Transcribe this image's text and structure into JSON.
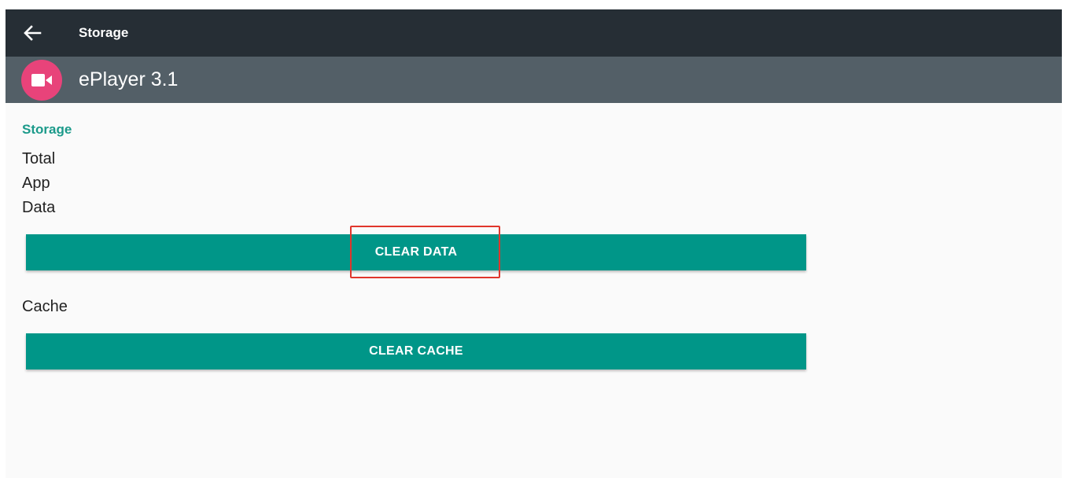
{
  "toolbar": {
    "title": "Storage",
    "back_icon": "arrow-left-icon"
  },
  "app": {
    "name": "ePlayer 3.1",
    "icon": "video-camera-icon",
    "icon_color": "#e8437a"
  },
  "storage": {
    "section_title": "Storage",
    "rows": {
      "total": "Total",
      "app": "App",
      "data": "Data",
      "cache": "Cache"
    },
    "clear_data_label": "CLEAR DATA",
    "clear_cache_label": "CLEAR CACHE"
  },
  "colors": {
    "toolbar_bg": "#262e35",
    "header_bg": "#535f67",
    "accent": "#009688",
    "section_text": "#1b9a8a",
    "highlight": "#e0362c"
  }
}
